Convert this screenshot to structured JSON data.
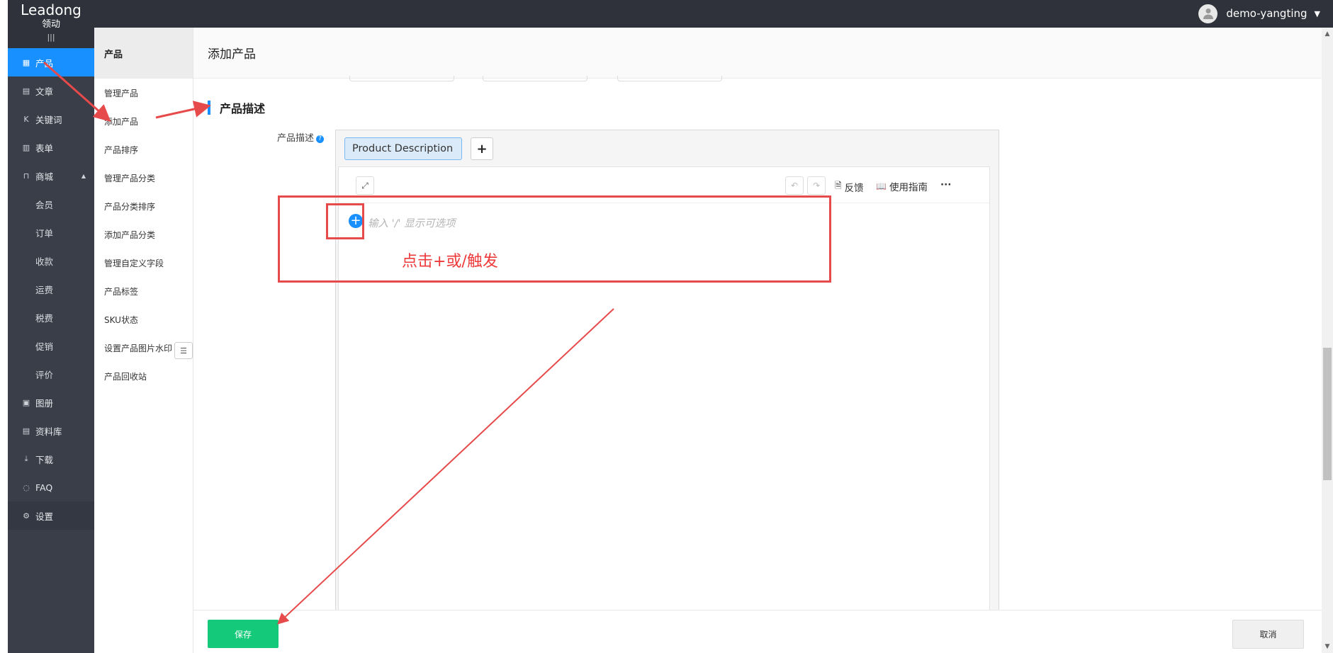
{
  "brand": {
    "name": "Leadong",
    "cn": "领动",
    "bars": "|||"
  },
  "user": {
    "name": "demo-yangting"
  },
  "sidebar": {
    "items": [
      {
        "label": "产品",
        "icon": "grid-icon",
        "glyph": "▦"
      },
      {
        "label": "文章",
        "icon": "article-icon",
        "glyph": "▤"
      },
      {
        "label": "关键词",
        "icon": "keyword-icon",
        "glyph": "K"
      },
      {
        "label": "表单",
        "icon": "form-icon",
        "glyph": "▥"
      },
      {
        "label": "商城",
        "icon": "shop-icon",
        "glyph": "⊓"
      }
    ],
    "shop_sub": [
      "会员",
      "订单",
      "收款",
      "运费",
      "税费",
      "促销",
      "评价"
    ],
    "bottom_items": [
      {
        "label": "图册",
        "icon": "album-icon",
        "glyph": "▣"
      },
      {
        "label": "资料库",
        "icon": "library-icon",
        "glyph": "▤"
      },
      {
        "label": "下载",
        "icon": "download-icon",
        "glyph": "⤓"
      },
      {
        "label": "FAQ",
        "icon": "faq-icon",
        "glyph": "◌"
      },
      {
        "label": "设置",
        "icon": "settings-icon",
        "glyph": "⚙"
      }
    ]
  },
  "submenu": {
    "title": "产品",
    "items": [
      "管理产品",
      "添加产品",
      "产品排序",
      "管理产品分类",
      "产品分类排序",
      "添加产品分类",
      "管理自定义字段",
      "产品标签",
      "SKU状态",
      "设置产品图片水印",
      "产品回收站"
    ]
  },
  "page": {
    "title": "添加产品",
    "section_title": "产品描述",
    "field_label": "产品描述"
  },
  "editor": {
    "tab_label": "Product Description",
    "feedback": "反馈",
    "guide": "使用指南",
    "more": "···",
    "placeholder": "输入 '/' 显示可选项"
  },
  "annotation": {
    "text": "点击+或/触发",
    "color": "#e74a4a"
  },
  "footer": {
    "save": "保存",
    "cancel": "取消"
  },
  "colors": {
    "accent": "#1890ff",
    "save": "#14c97a",
    "sidebar": "#3a3e49",
    "topbar": "#2f323b"
  }
}
